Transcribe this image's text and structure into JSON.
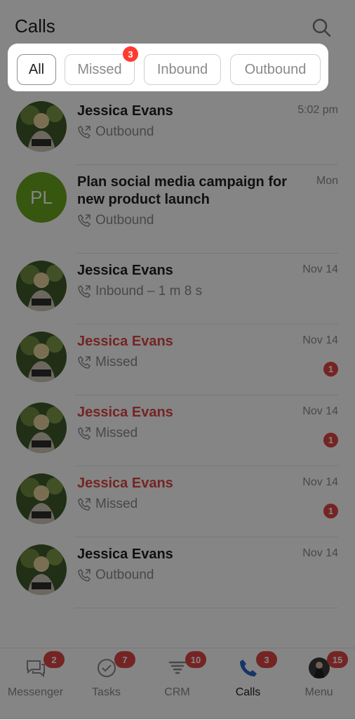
{
  "header": {
    "title": "Calls"
  },
  "filters": {
    "all": "All",
    "missed": "Missed",
    "missed_badge": "3",
    "inbound": "Inbound",
    "outbound": "Outbound"
  },
  "calls": [
    {
      "name": "Jessica Evans",
      "type": "Outbound",
      "time": "5:02 pm",
      "missed": false,
      "badge": null,
      "avatar": "photo"
    },
    {
      "name": "Plan social media campaign for new product launch",
      "type": "Outbound",
      "time": "Mon",
      "missed": false,
      "badge": null,
      "avatar": "initials",
      "initials": "PL"
    },
    {
      "name": "Jessica Evans",
      "type": "Inbound – 1 m 8 s",
      "time": "Nov 14",
      "missed": false,
      "badge": null,
      "avatar": "photo"
    },
    {
      "name": "Jessica Evans",
      "type": "Missed",
      "time": "Nov 14",
      "missed": true,
      "badge": "1",
      "avatar": "photo"
    },
    {
      "name": "Jessica Evans",
      "type": "Missed",
      "time": "Nov 14",
      "missed": true,
      "badge": "1",
      "avatar": "photo"
    },
    {
      "name": "Jessica Evans",
      "type": "Missed",
      "time": "Nov 14",
      "missed": true,
      "badge": "1",
      "avatar": "photo"
    },
    {
      "name": "Jessica Evans",
      "type": "Outbound",
      "time": "Nov 14",
      "missed": false,
      "badge": null,
      "avatar": "photo"
    }
  ],
  "nav": [
    {
      "label": "Messenger",
      "badge": "2",
      "icon": "chat-icon"
    },
    {
      "label": "Tasks",
      "badge": "7",
      "icon": "check-circle-icon"
    },
    {
      "label": "CRM",
      "badge": "10",
      "icon": "funnel-icon"
    },
    {
      "label": "Calls",
      "badge": "3",
      "icon": "phone-icon",
      "active": true
    },
    {
      "label": "Menu",
      "badge": "15",
      "icon": "avatar-icon"
    }
  ],
  "colors": {
    "missed": "#e04646",
    "initials_bg": "#6aa51f",
    "active_icon": "#2a66c8"
  }
}
